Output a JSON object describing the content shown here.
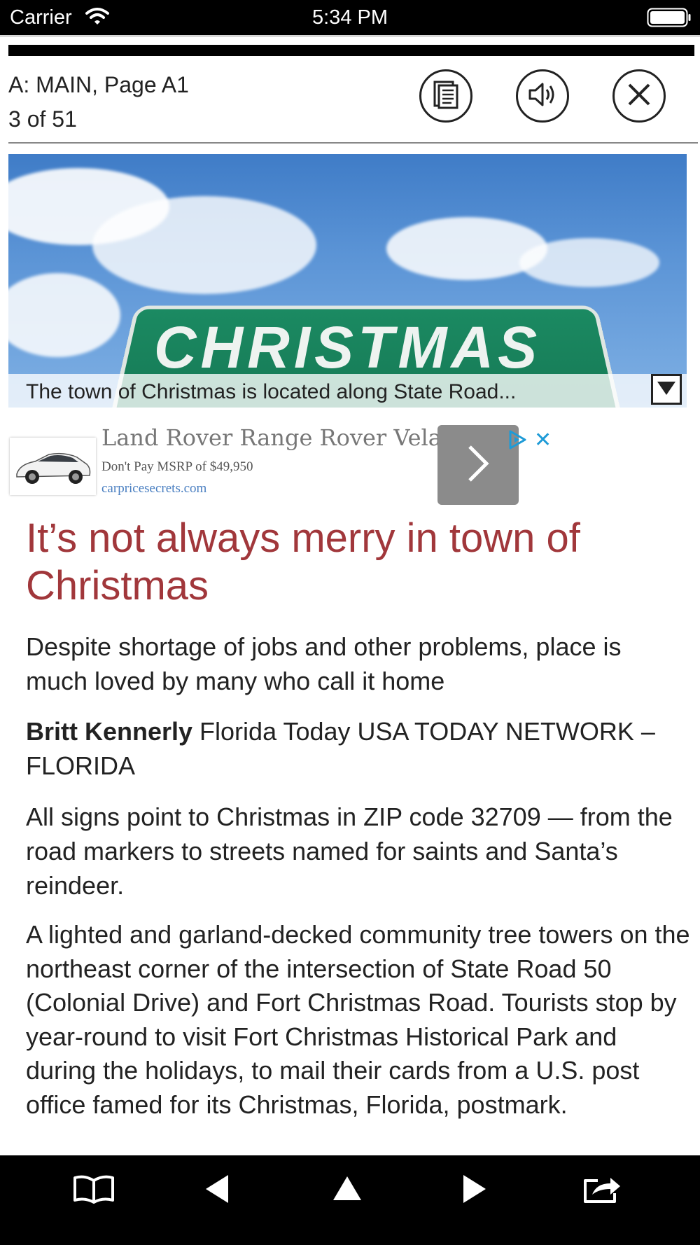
{
  "status_bar": {
    "carrier": "Carrier",
    "time": "5:34 PM",
    "wifi_icon": "wifi-icon",
    "battery_icon": "battery-icon"
  },
  "header": {
    "section": "A: MAIN, Page A1",
    "page_position": "3 of 51",
    "buttons": [
      "page-view-icon",
      "speaker-icon",
      "close-icon"
    ]
  },
  "hero": {
    "sign_text": "CHRISTMAS",
    "caption": "The town of Christmas is located along State Road...",
    "toggle_icon": "triangle-down-icon"
  },
  "ad": {
    "title": "Land Rover Range Rover Velar",
    "subtitle": "Don't Pay MSRP of $49,950",
    "url": "carpricesecrets.com",
    "cta_icon": "chevron-right-icon",
    "choices_icon": "adchoices-icon",
    "close_label": "✕"
  },
  "article": {
    "headline": "It’s not always merry in town of Christmas",
    "deck": "Despite shortage of jobs and other problems, place is much loved by many who call it home",
    "author": "Britt Kennerly",
    "byline_rest": " Florida Today USA TODAY NETWORK – FLORIDA",
    "paragraphs": [
      "All signs point to Christmas in ZIP code 32709 — from the road markers to streets named for saints and Santa’s reindeer.",
      "A lighted and garland-decked community tree towers on the northeast corner of the intersection of State Road 50 (Colonial Drive) and Fort Christmas Road. Tourists stop by year-round to visit Fort Christmas Historical Park and during the holidays, to mail their cards from a U.S. post office famed for its Christmas, Florida, postmark."
    ]
  },
  "toolbar": {
    "items": [
      "book-icon",
      "previous-icon",
      "up-icon",
      "next-icon",
      "share-icon"
    ]
  },
  "colors": {
    "headline": "#a1373b",
    "toolbar_bg": "#000000",
    "ad_link": "#4a7fc1",
    "sign_green": "#157552"
  }
}
